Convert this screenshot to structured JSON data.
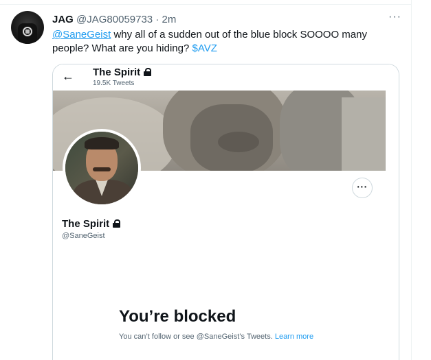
{
  "tweet": {
    "author_name": "JAG",
    "author_handle": "@JAG80059733",
    "separator": "·",
    "time": "2m",
    "more_label": "···",
    "mention": "@SaneGeist",
    "text_after_mention": " why all of a sudden out of the blue block SOOOO many people? What are you hiding? ",
    "cashtag": "$AVZ"
  },
  "card": {
    "back_label": "←",
    "title": "The Spirit",
    "tweet_count": "19.5K Tweets",
    "profile_name": "The Spirit",
    "profile_handle": "@SaneGeist",
    "more_label": "···",
    "blocked_title": "You’re blocked",
    "blocked_desc": "You can’t follow or see @SaneGeist’s Tweets.",
    "learn_more": "Learn more"
  },
  "colors": {
    "accent": "#1d9bf0",
    "text_primary": "#0f1419",
    "text_secondary": "#536471",
    "border": "#cfd9de"
  },
  "icons": {
    "back": "arrow-left-icon",
    "lock": "lock-icon",
    "more": "more-horizontal-icon"
  }
}
